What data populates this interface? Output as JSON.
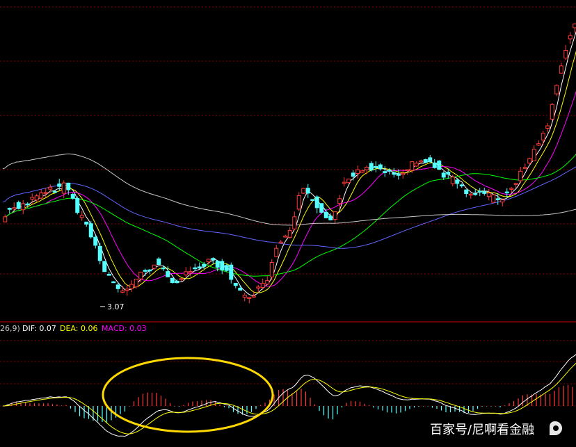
{
  "chart_data": [
    {
      "type": "candlestick",
      "title": "",
      "panel": "price",
      "annotations": [
        {
          "text": "3.07",
          "x": 40,
          "y": 3.07
        }
      ],
      "up_color": "#ff3c3c",
      "down_color": "#54ffff",
      "grid": true,
      "grid_style": "dashed-red",
      "moving_averages": [
        {
          "color": "#ffffff"
        },
        {
          "color": "#ffff00"
        },
        {
          "color": "#ff00ff"
        },
        {
          "color": "#00ff00"
        },
        {
          "color": "#6464ff"
        },
        {
          "color": "#c8c8c8"
        }
      ]
    },
    {
      "type": "macd",
      "panel": "indicator",
      "legend_prefix": "26,9)",
      "legend": [
        {
          "label": "DIF: 0.07",
          "color": "#ffffff"
        },
        {
          "label": "DEA: 0.06",
          "color": "#ffff00"
        },
        {
          "label": "MACD: 0.03",
          "color": "#ff00ff"
        }
      ],
      "histogram_colors": {
        "positive": "#ff3c3c",
        "negative": "#54ffff"
      },
      "highlight": {
        "shape": "ellipse",
        "color": "#ffd800"
      }
    }
  ],
  "watermark": {
    "text": "百家号/尼啊看金融",
    "icon": "baijiahao-logo-icon"
  }
}
